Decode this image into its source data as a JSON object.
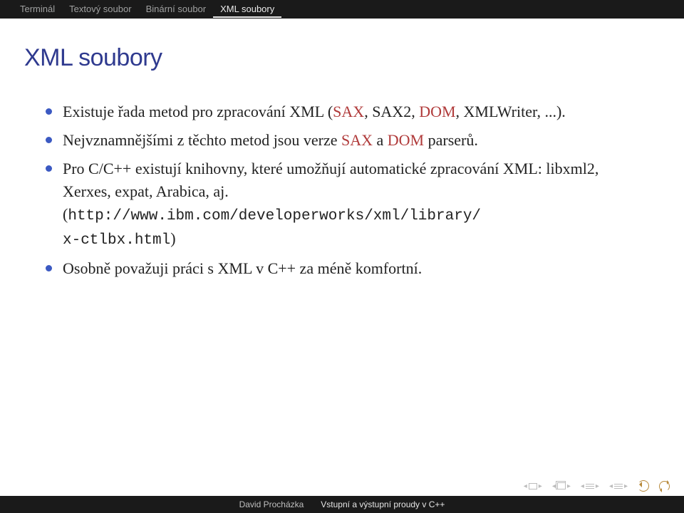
{
  "tabs": {
    "items": [
      {
        "label": "Terminál"
      },
      {
        "label": "Textový soubor"
      },
      {
        "label": "Binární soubor"
      },
      {
        "label": "XML soubory"
      }
    ],
    "active_index": 3
  },
  "title": "XML soubory",
  "bullets": [
    {
      "pre": "Existuje řada metod pro zpracování XML (",
      "kw1": "SAX",
      "mid1": ", SAX2, ",
      "kw2": "DOM",
      "post": ", XMLWriter, ...)."
    },
    {
      "pre": "Nejvznamnějšími z těchto metod jsou verze ",
      "kw1": "SAX",
      "mid1": " a ",
      "kw2": "DOM",
      "post": " parserů."
    },
    {
      "text": "Pro C/C++ existují knihovny, které umožňují automatické zpracování XML: libxml2, Xerxes, expat, Arabica, aj. (",
      "url1": "http://www.ibm.com/developerworks/xml/library/",
      "url2": "x-ctlbx.html",
      "tail": ")"
    },
    {
      "text": "Osobně považuji práci s XML v C++ za méně komfortní."
    }
  ],
  "footer": {
    "author": "David Procházka",
    "title": "Vstupní a výstupní proudy v C++"
  }
}
